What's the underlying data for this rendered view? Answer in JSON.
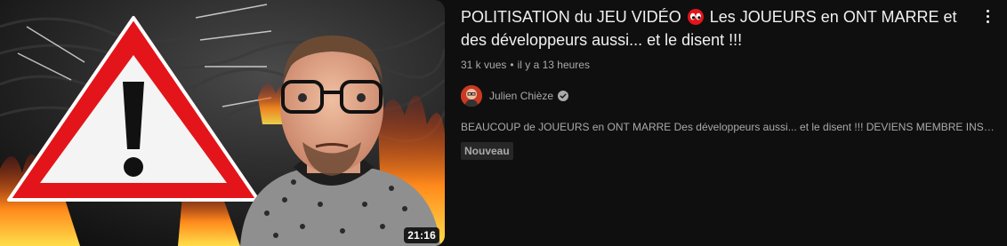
{
  "video": {
    "title_before": "POLITISATION du JEU VIDÉO",
    "title_emoji": "eyes-emoji",
    "title_after": "Les JOUEURS en ONT MARRE et des développeurs aussi... et le disent !!!",
    "duration": "21:16",
    "views": "31 k vues",
    "separator": "•",
    "published": "il y a 13 heures",
    "description": "BEAUCOUP de JOUEURS en ONT MARRE Des développeurs aussi... et le disent !!! DEVIENS MEMBRE INSIDER pour ..."
  },
  "channel": {
    "name": "Julien Chièze",
    "verified_icon": "verified-check-icon"
  },
  "badge": {
    "label": "Nouveau"
  },
  "colors": {
    "background": "#0f0f0f",
    "primary_text": "#f1f1f1",
    "secondary_text": "#aaaaaa",
    "badge_bg": "#272727",
    "warning_red": "#e3151a"
  },
  "icons": {
    "menu": "more-vert-icon"
  }
}
